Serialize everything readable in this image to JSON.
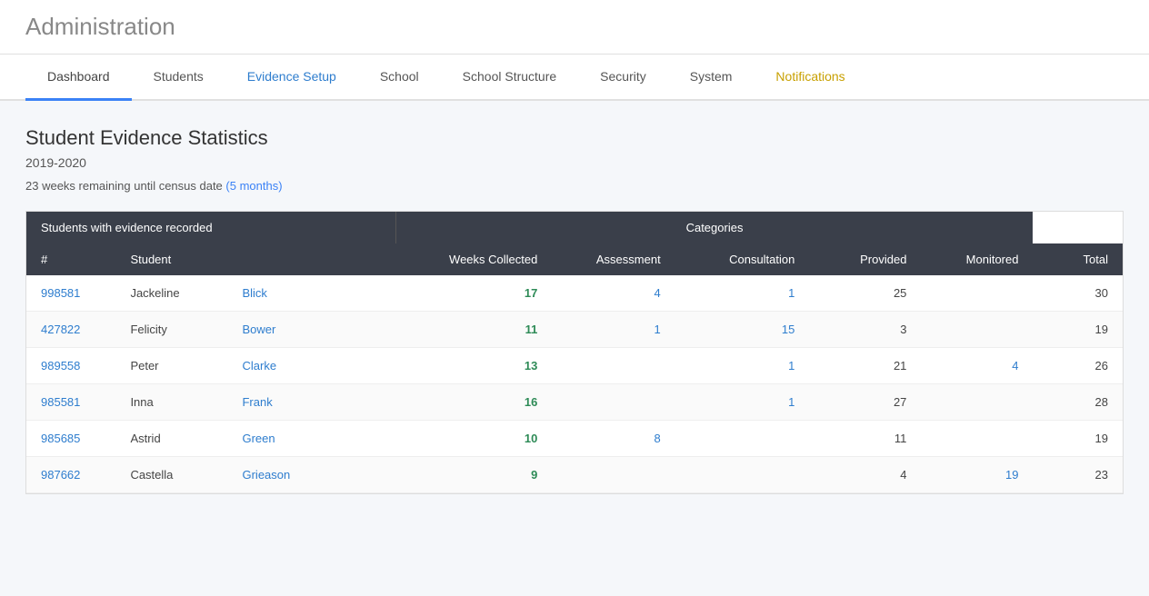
{
  "header": {
    "title": "Administration"
  },
  "nav": {
    "tabs": [
      {
        "id": "dashboard",
        "label": "Dashboard",
        "active": true,
        "style": "active"
      },
      {
        "id": "students",
        "label": "Students",
        "active": false,
        "style": "normal"
      },
      {
        "id": "evidence-setup",
        "label": "Evidence Setup",
        "active": false,
        "style": "link-blue"
      },
      {
        "id": "school",
        "label": "School",
        "active": false,
        "style": "normal"
      },
      {
        "id": "school-structure",
        "label": "School Structure",
        "active": false,
        "style": "normal"
      },
      {
        "id": "security",
        "label": "Security",
        "active": false,
        "style": "normal"
      },
      {
        "id": "system",
        "label": "System",
        "active": false,
        "style": "normal"
      },
      {
        "id": "notifications",
        "label": "Notifications",
        "active": false,
        "style": "notifications"
      }
    ]
  },
  "main": {
    "title": "Student Evidence Statistics",
    "year": "2019-2020",
    "census_notice": "23 weeks remaining until census date",
    "census_months": "(5 months)",
    "table": {
      "section_label": "Students with evidence recorded",
      "categories_label": "Categories",
      "columns": [
        "#",
        "Student",
        "Weeks Collected",
        "Assessment",
        "Consultation",
        "Provided",
        "Monitored",
        "Total"
      ],
      "rows": [
        {
          "id": "998581",
          "first": "Jackeline",
          "last": "Blick",
          "weeks": "17",
          "assessment": "4",
          "consultation": "1",
          "provided": "25",
          "monitored": "",
          "total": "30"
        },
        {
          "id": "427822",
          "first": "Felicity",
          "last": "Bower",
          "weeks": "11",
          "assessment": "1",
          "consultation": "15",
          "provided": "3",
          "monitored": "",
          "total": "19"
        },
        {
          "id": "989558",
          "first": "Peter",
          "last": "Clarke",
          "weeks": "13",
          "assessment": "",
          "consultation": "1",
          "provided": "21",
          "monitored": "4",
          "total": "26"
        },
        {
          "id": "985581",
          "first": "Inna",
          "last": "Frank",
          "weeks": "16",
          "assessment": "",
          "consultation": "1",
          "provided": "27",
          "monitored": "",
          "total": "28"
        },
        {
          "id": "985685",
          "first": "Astrid",
          "last": "Green",
          "weeks": "10",
          "assessment": "8",
          "consultation": "",
          "provided": "11",
          "monitored": "",
          "total": "19"
        },
        {
          "id": "987662",
          "first": "Castella",
          "last": "Grieason",
          "weeks": "9",
          "assessment": "",
          "consultation": "",
          "provided": "4",
          "monitored": "19",
          "total": "23"
        }
      ]
    }
  }
}
